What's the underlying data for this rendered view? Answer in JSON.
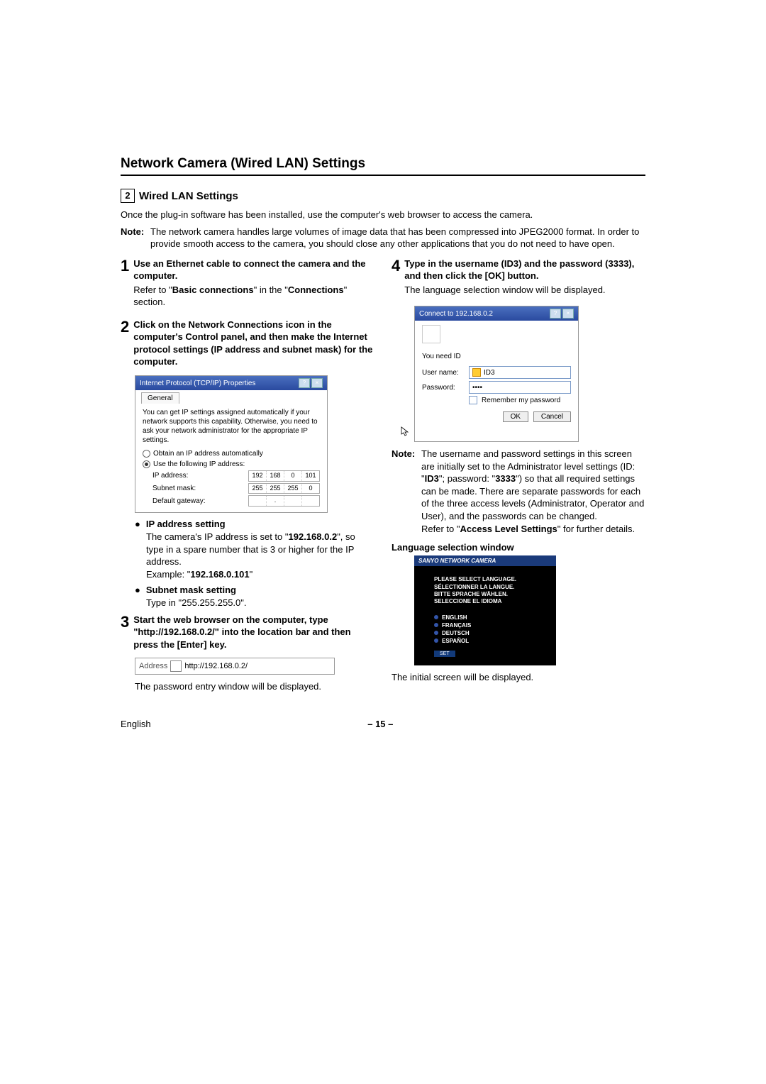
{
  "title": "Network Camera (Wired LAN) Settings",
  "section_number": "2",
  "section_title": "Wired LAN Settings",
  "intro": "Once the plug-in software has been installed, use the computer's web browser to access the camera.",
  "note_label": "Note:",
  "note": "The network camera handles large volumes of image data that has been compressed into JPEG2000 format. In order to provide smooth access to the camera, you should close any other applications that you do not need to have open.",
  "step1": {
    "num": "1",
    "head": "Use an Ethernet cable to connect the camera and the computer.",
    "body_pre": "Refer to \"",
    "body_bold": "Basic connections",
    "body_mid": "\" in the \"",
    "body_bold2": "Connections",
    "body_post": "\" section."
  },
  "step2": {
    "num": "2",
    "head": "Click on the Network Connections icon in the computer's Control panel, and then make the Internet protocol settings (IP address and subnet mask) for the computer."
  },
  "tcp_dialog": {
    "title": "Internet Protocol (TCP/IP) Properties",
    "tab": "General",
    "desc": "You can get IP settings assigned automatically if your network supports this capability. Otherwise, you need to ask your network administrator for the appropriate IP settings.",
    "opt_auto": "Obtain an IP address automatically",
    "opt_use": "Use the following IP address:",
    "ip_label": "IP address:",
    "ip": [
      "192",
      "168",
      "0",
      "101"
    ],
    "mask_label": "Subnet mask:",
    "mask": [
      "255",
      "255",
      "255",
      "0"
    ],
    "gw_label": "Default gateway:",
    "gw": [
      "",
      ".",
      "",
      ""
    ]
  },
  "bullet_ip_head": "IP address setting",
  "bullet_ip_body1": "The camera's IP address is set to \"",
  "bullet_ip_bold1": "192.168.0.2",
  "bullet_ip_body2": "\", so type in a spare number that is 3 or higher for the IP address.",
  "bullet_ip_ex_pre": "Example: \"",
  "bullet_ip_ex_bold": "192.168.0.101",
  "bullet_ip_ex_post": "\"",
  "bullet_mask_head": "Subnet mask setting",
  "bullet_mask_body": "Type in \"255.255.255.0\".",
  "step3": {
    "num": "3",
    "head": "Start the web browser on the computer, type \"http://192.168.0.2/\" into the location bar and then press the [Enter] key."
  },
  "addr_label": "Address",
  "addr_value": "http://192.168.0.2/",
  "step3_after": "The password entry window will be displayed.",
  "step4": {
    "num": "4",
    "head": "Type in the username (ID3) and the password (3333), and then click the [OK] button.",
    "body": "The language selection window will be displayed."
  },
  "login_dialog": {
    "title": "Connect to 192.168.0.2",
    "need": "You need ID",
    "user_label": "User name:",
    "user_value": "ID3",
    "pw_label": "Password:",
    "pw_value": "••••",
    "remember": "Remember my password",
    "ok": "OK",
    "cancel": "Cancel"
  },
  "note2_label": "Note:",
  "note2_a": "The username and password settings in this screen are initially set to the Administrator level settings (ID: \"",
  "note2_id": "ID3",
  "note2_b": "\"; password: \"",
  "note2_pw": "3333",
  "note2_c": "\") so that all required settings can be made. There are separate passwords for each of the three access levels (Administrator, Operator and User), and the passwords can be changed.",
  "note2_d": "Refer to \"",
  "note2_bold": "Access Level Settings",
  "note2_e": "\" for further details.",
  "lang_caption": "Language selection window",
  "lang_window": {
    "header": "SANYO NETWORK CAMERA",
    "msg1": "PLEASE SELECT LANGUAGE.",
    "msg2": "SÉLECTIONNER LA LANGUE.",
    "msg3": "BITTE SPRACHE WÄHLEN.",
    "msg4": "SELECCIONE EL IDIOMA",
    "langs": [
      "ENGLISH",
      "FRANÇAIS",
      "DEUTSCH",
      "ESPAÑOL"
    ],
    "set": "SET"
  },
  "lang_after": "The initial screen will be displayed.",
  "footer_lang": "English",
  "page_num": "– 15 –",
  "chart_data": null
}
